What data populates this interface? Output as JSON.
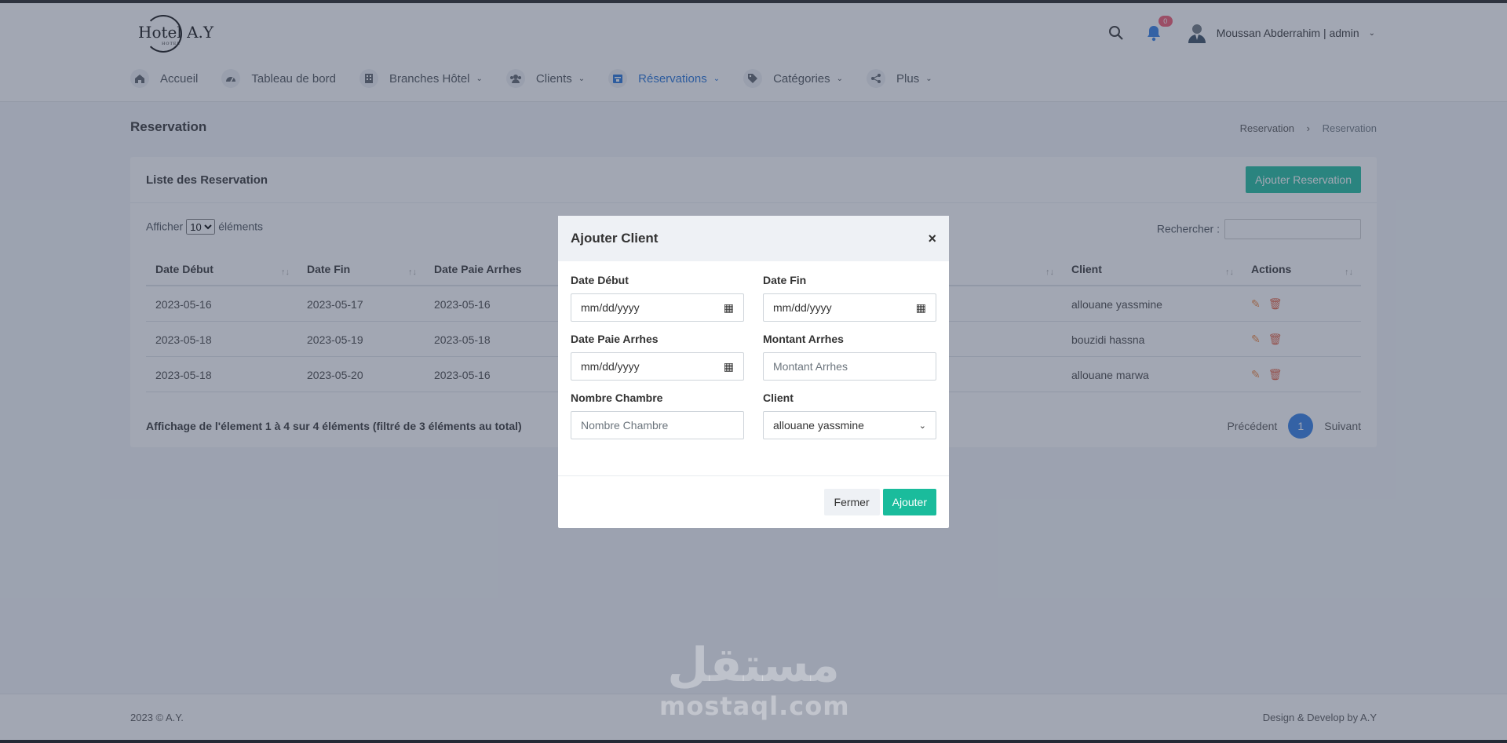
{
  "brand": {
    "logo_text": "Hotel A.Y",
    "logo_sub": "HOTEL"
  },
  "header": {
    "notif_count": "0",
    "user_label": "Moussan Abderrahim | admin"
  },
  "nav": {
    "items": [
      {
        "label": "Accueil"
      },
      {
        "label": "Tableau de bord"
      },
      {
        "label": "Branches Hôtel"
      },
      {
        "label": "Clients"
      },
      {
        "label": "Réservations"
      },
      {
        "label": "Catégories"
      },
      {
        "label": "Plus"
      }
    ]
  },
  "page": {
    "title": "Reservation",
    "breadcrumb": [
      "Reservation",
      "Reservation"
    ]
  },
  "card": {
    "title": "Liste des Reservation",
    "add_button": "Ajouter Reservation",
    "show_label": "Afficher",
    "show_value": "10",
    "show_suffix": "éléments",
    "search_label": "Rechercher :"
  },
  "table": {
    "headers": [
      "Date Début",
      "Date Fin",
      "Date Paie Arrhes",
      "Client",
      "Actions"
    ],
    "rows": [
      [
        "2023-05-16",
        "2023-05-17",
        "2023-05-16",
        "allouane yassmine"
      ],
      [
        "2023-05-18",
        "2023-05-19",
        "2023-05-18",
        "bouzidi hassna"
      ],
      [
        "2023-05-18",
        "2023-05-20",
        "2023-05-16",
        "allouane marwa"
      ]
    ],
    "info": "Affichage de l'élement 1 à 4 sur 4 éléments (filtré de 3 éléments au total)",
    "prev": "Précédent",
    "page": "1",
    "next": "Suivant"
  },
  "modal": {
    "title": "Ajouter Client",
    "close": "×",
    "fields": {
      "date_debut_label": "Date Début",
      "date_debut_value": "mm/dd/yyyy",
      "date_fin_label": "Date Fin",
      "date_fin_value": "mm/dd/yyyy",
      "date_paie_label": "Date Paie Arrhes",
      "date_paie_value": "mm/dd/yyyy",
      "montant_label": "Montant Arrhes",
      "montant_placeholder": "Montant Arrhes",
      "nombre_label": "Nombre Chambre",
      "nombre_placeholder": "Nombre Chambre",
      "client_label": "Client",
      "client_value": "allouane yassmine"
    },
    "close_button": "Fermer",
    "submit_button": "Ajouter"
  },
  "footer": {
    "left": "2023 © A.Y.",
    "right": "Design & Develop by A.Y"
  },
  "watermark": {
    "arabic": "مستقل",
    "latin": "mostaql.com"
  },
  "colors": {
    "accent": "#1abc9c",
    "primary": "#2c7be5",
    "danger": "#f1556c"
  }
}
